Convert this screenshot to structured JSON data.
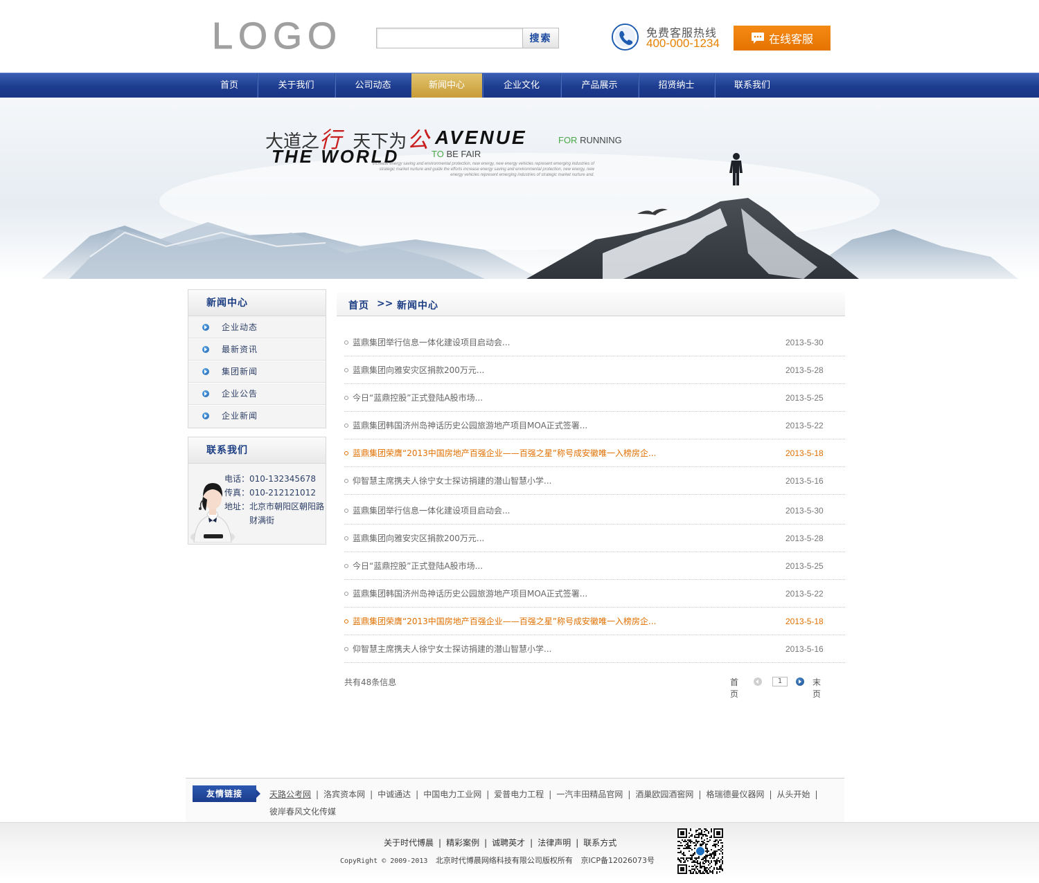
{
  "header": {
    "logo": "LOGO",
    "search": {
      "placeholder": "",
      "button": "搜索"
    },
    "hotline_label": "免费客服热线",
    "hotline_number": "400-000-1234",
    "service_button": "在线客服",
    "accent_color": "#f07e08"
  },
  "nav": {
    "items": [
      "首页",
      "关于我们",
      "公司动态",
      "新闻中心",
      "企业文化",
      "产品展示",
      "招贤纳士",
      "联系我们"
    ],
    "active": "新闻中心",
    "bg_color": "#1d3c8f",
    "active_color": "#d4ac4f"
  },
  "banner": {
    "cn_part1": "大道之",
    "cn_red1": "行",
    "cn_part2": "天下为",
    "cn_red2": "公",
    "en_big1": "AVENUE",
    "en_small1_green": "FOR",
    "en_small1": "RUNNING",
    "en_big2": "THE WORLD",
    "en_small2_green": "TO",
    "en_small2": "BE FAIR",
    "fine_print": "increase energy saving and environmental protection, new energy, new energy vehicles represent emerging industries of strategic market nurture and guide the efforts increase energy saving and environmental protection, new energy, new energy vehicles represent emerging industries of strategic market nurture and."
  },
  "sidebar": {
    "news_title": "新闻中心",
    "news_items": [
      "企业动态",
      "最新资讯",
      "集团新闻",
      "企业公告",
      "企业新闻"
    ],
    "contact_title": "联系我们",
    "contact": {
      "phone_label": "电话：",
      "phone": "010-132345678",
      "fax_label": "传真：",
      "fax": "010-212121012",
      "address_label": "地址：",
      "address": "北京市朝阳区朝阳路财满街"
    }
  },
  "breadcrumb": {
    "home": "首页",
    "separator": ">>",
    "current": "新闻中心"
  },
  "news": [
    {
      "title": "蓝鼎集团举行信息一体化建设项目启动会...",
      "date": "2013-5-30",
      "hot": false
    },
    {
      "title": "蓝鼎集团向雅安灾区捐款200万元...",
      "date": "2013-5-28",
      "hot": false
    },
    {
      "title": "今日“蓝鼎控股”正式登陆A股市场...",
      "date": "2013-5-25",
      "hot": false
    },
    {
      "title": "蓝鼎集团韩国济州岛神话历史公园旅游地产项目MOA正式签署...",
      "date": "2013-5-22",
      "hot": false
    },
    {
      "title": "蓝鼎集团荣膺“2013中国房地产百强企业——百强之星”称号成安徽唯一入榜房企...",
      "date": "2013-5-18",
      "hot": true
    },
    {
      "title": "仰智慧主席携夫人徐宁女士探访捐建的潜山智慧小学...",
      "date": "2013-5-16",
      "hot": false
    },
    {
      "title": "蓝鼎集团举行信息一体化建设项目启动会...",
      "date": "2013-5-30",
      "hot": false
    },
    {
      "title": "蓝鼎集团向雅安灾区捐款200万元...",
      "date": "2013-5-28",
      "hot": false
    },
    {
      "title": "今日“蓝鼎控股”正式登陆A股市场...",
      "date": "2013-5-25",
      "hot": false
    },
    {
      "title": "蓝鼎集团韩国济州岛神话历史公园旅游地产项目MOA正式签署...",
      "date": "2013-5-22",
      "hot": false
    },
    {
      "title": "蓝鼎集团荣膺“2013中国房地产百强企业——百强之星”称号成安徽唯一入榜房企...",
      "date": "2013-5-18",
      "hot": true
    },
    {
      "title": "仰智慧主席携夫人徐宁女士探访捐建的潜山智慧小学...",
      "date": "2013-5-16",
      "hot": false
    }
  ],
  "pagination": {
    "total_text": "共有48条信息",
    "first": "首页",
    "current_page": "1",
    "last": "末页"
  },
  "friend_links": {
    "label": "友情链接",
    "items": [
      "天路公考网",
      "洛宾资本网",
      "中诚通达",
      "中国电力工业网",
      "爱普电力工程",
      "一汽丰田精品官网",
      "酒巢欧园酒窖网",
      "格瑞德曼仪器网",
      "从头开始",
      "彼岸春风文化传媒"
    ]
  },
  "footer": {
    "links": [
      "关于时代博晨",
      "精彩案例",
      "诚聘英才",
      "法律声明",
      "联系方式"
    ],
    "copyright_prefix": "CopyRight © 2009-2013",
    "copyright_company": "北京时代博晨网络科技有限公司版权所有",
    "icp": "京ICP备12026073号"
  }
}
